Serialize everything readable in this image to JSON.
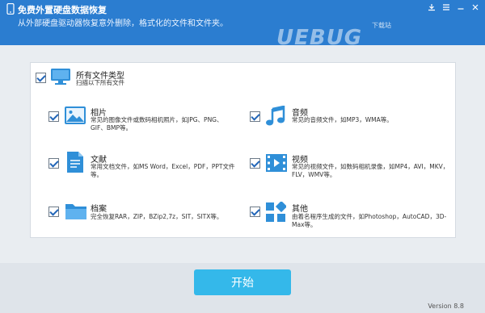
{
  "header": {
    "title": "免费外置硬盘数据恢复",
    "subtitle": "从外部硬盘驱动器恢复意外删除，格式化的文件和文件夹。",
    "controls": [
      "download-icon",
      "menu-icon",
      "minimize-icon",
      "close-icon"
    ]
  },
  "watermark": {
    "main": "UEBUG",
    "sub": "下载站"
  },
  "all_types": {
    "title": "所有文件类型",
    "desc": "扫描以下所有文件"
  },
  "types": [
    {
      "title": "相片",
      "desc": "常见的图像文件或数码相机照片，如JPG、PNG、GIF、BMP等。"
    },
    {
      "title": "音频",
      "desc": "常见的音频文件，如MP3，WMA等。"
    },
    {
      "title": "文献",
      "desc": "常用文档文件，如MS Word，Excel，PDF，PPT文件等。"
    },
    {
      "title": "视频",
      "desc": "常见的视频文件，如数码相机录像，如MP4，AVI，MKV，FLV，WMV等。"
    },
    {
      "title": "档案",
      "desc": "完全恢复RAR，ZIP，BZip2,7z，SIT，SITX等。"
    },
    {
      "title": "其他",
      "desc": "由着名程序生成的文件，如Photoshop，AutoCAD，3D-Max等。"
    }
  ],
  "start_button": "开始",
  "version": "Version 8.8",
  "colors": {
    "header": "#2b7dd0",
    "accent": "#34b8ea",
    "icon_blue": "#2f8fd8"
  }
}
